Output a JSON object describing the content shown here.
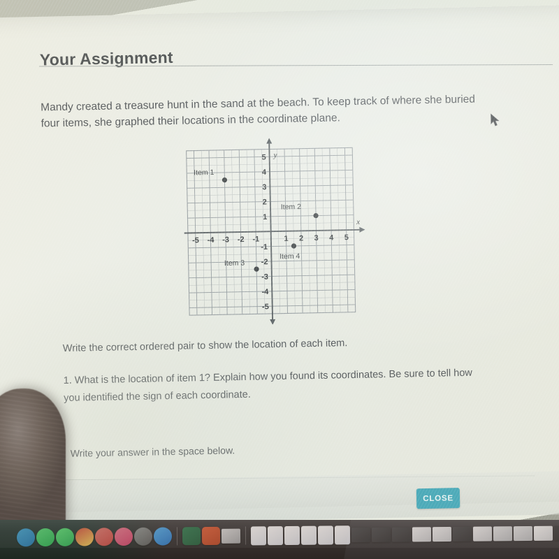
{
  "window": {
    "title": "Your Assignment"
  },
  "assignment": {
    "intro": "Mandy created a treasure hunt in the sand at the beach. To keep track of where she buried four items, she graphed their locations in the coordinate plane.",
    "instruction": "Write the correct ordered pair to show the location of each item.",
    "question_1": "1. What is the location of item 1? Explain how you found its coordinates. Be sure to tell how you identified the sign of each coordinate.",
    "answer_prompt": "Write your answer in the space below."
  },
  "footer": {
    "close_label": "CLOSE",
    "close_color": "#2e9fb4"
  },
  "chart_data": {
    "type": "scatter",
    "title": "",
    "xlabel": "x",
    "ylabel": "y",
    "xlim": [
      -5.5,
      5.5
    ],
    "ylim": [
      -5.5,
      5.5
    ],
    "grid": true,
    "minor_grid_step": 0.5,
    "major_grid_step": 1,
    "xticks": [
      -5,
      -4,
      -3,
      -2,
      -1,
      1,
      2,
      3,
      4,
      5
    ],
    "yticks": [
      5,
      4,
      3,
      2,
      1,
      -1,
      -2,
      -3,
      -4,
      -5
    ],
    "xtick_labels": [
      "-5",
      "-4",
      "-3",
      "-2",
      "-1",
      "1",
      "2",
      "3",
      "4",
      "5"
    ],
    "ytick_labels": [
      "5",
      "4",
      "3",
      "2",
      "1",
      "-1",
      "-2",
      "-3",
      "-4",
      "-5"
    ],
    "points": [
      {
        "label": "Item 1",
        "x": -3,
        "y": 3.5,
        "label_dx": -44,
        "label_dy": -8
      },
      {
        "label": "Item 2",
        "x": 3,
        "y": 1,
        "label_dx": -50,
        "label_dy": -10
      },
      {
        "label": "Item 3",
        "x": -1,
        "y": -2.5,
        "label_dx": -46,
        "label_dy": -6
      },
      {
        "label": "Item 4",
        "x": 1.5,
        "y": -1,
        "label_dx": -6,
        "label_dy": 18
      }
    ],
    "point_color": "#2b2f31",
    "grid_color": "#8d9499",
    "axis_color": "#4c5256"
  },
  "dock": {
    "items": [
      {
        "name": "finder-icon",
        "color1": "#3a9ad9",
        "color2": "#1d6fb8",
        "shape": "round"
      },
      {
        "name": "messages-icon",
        "color1": "#4fd06a",
        "color2": "#1faa46",
        "shape": "round"
      },
      {
        "name": "facetime-icon",
        "color1": "#53d769",
        "color2": "#22a94a",
        "shape": "round"
      },
      {
        "name": "chrome-icon",
        "color1": "#e9453a",
        "color2": "#f5c242",
        "shape": "round"
      },
      {
        "name": "do-not-disturb-icon",
        "color1": "#f06a6a",
        "color2": "#d93b3b",
        "shape": "round"
      },
      {
        "name": "music-icon",
        "color1": "#f56b8c",
        "color2": "#e0356b",
        "shape": "round"
      },
      {
        "name": "system-preferences-icon",
        "color1": "#8d8f93",
        "color2": "#55585c",
        "shape": "round"
      },
      {
        "name": "app-store-icon",
        "color1": "#3fa9f5",
        "color2": "#1273d3",
        "shape": "round"
      },
      {
        "name": "separator",
        "shape": "sep"
      },
      {
        "name": "excel-icon",
        "color1": "#1f7a4d",
        "color2": "#0f5c36",
        "shape": "square"
      },
      {
        "name": "powerpoint-icon",
        "color1": "#e8552d",
        "color2": "#c23c18",
        "shape": "square"
      },
      {
        "name": "screenshot-icon",
        "color1": "#cfd2d6",
        "color2": "#9aa0a6",
        "shape": "window"
      },
      {
        "name": "separator",
        "shape": "sep"
      },
      {
        "name": "word-doc-icon",
        "color1": "#f2f4f7",
        "color2": "#cfd6e2",
        "shape": "doc"
      },
      {
        "name": "pdf-doc-icon",
        "color1": "#f2f4f7",
        "color2": "#cfd6e2",
        "shape": "doc"
      },
      {
        "name": "pdf-doc-icon",
        "color1": "#f2f4f7",
        "color2": "#cfd6e2",
        "shape": "doc"
      },
      {
        "name": "pdf-doc-icon",
        "color1": "#f2f4f7",
        "color2": "#cfd6e2",
        "shape": "doc"
      },
      {
        "name": "pdf-doc-icon",
        "color1": "#f2f4f7",
        "color2": "#cfd6e2",
        "shape": "doc"
      },
      {
        "name": "pdf-doc-icon",
        "color1": "#f2f4f7",
        "color2": "#cfd6e2",
        "shape": "doc"
      },
      {
        "name": "browser-window-icon",
        "color1": "#3b3f44",
        "color2": "#222529",
        "shape": "window"
      },
      {
        "name": "browser-window-icon",
        "color1": "#3b3f44",
        "color2": "#222529",
        "shape": "window"
      },
      {
        "name": "browser-window-icon",
        "color1": "#3b3f44",
        "color2": "#222529",
        "shape": "window"
      },
      {
        "name": "browser-window-icon",
        "color1": "#e7e9ec",
        "color2": "#b9bec4",
        "shape": "window"
      },
      {
        "name": "browser-window-icon",
        "color1": "#e7e9ec",
        "color2": "#b9bec4",
        "shape": "window"
      },
      {
        "name": "browser-window-icon",
        "color1": "#3b3f44",
        "color2": "#222529",
        "shape": "window"
      },
      {
        "name": "browser-window-icon",
        "color1": "#e7e9ec",
        "color2": "#b9bec4",
        "shape": "window"
      },
      {
        "name": "browser-window-icon",
        "color1": "#d9dde1",
        "color2": "#aab0b6",
        "shape": "window"
      },
      {
        "name": "browser-window-icon",
        "color1": "#d9dde1",
        "color2": "#aab0b6",
        "shape": "window"
      },
      {
        "name": "browser-window-icon",
        "color1": "#eef0f2",
        "color2": "#c3c8cd",
        "shape": "window"
      },
      {
        "name": "browser-window-icon",
        "color1": "#2c2f33",
        "color2": "#1a1c1f",
        "shape": "window"
      },
      {
        "name": "browser-window-icon",
        "color1": "#e2e6e9",
        "color2": "#b3b9bf",
        "shape": "window"
      }
    ]
  }
}
